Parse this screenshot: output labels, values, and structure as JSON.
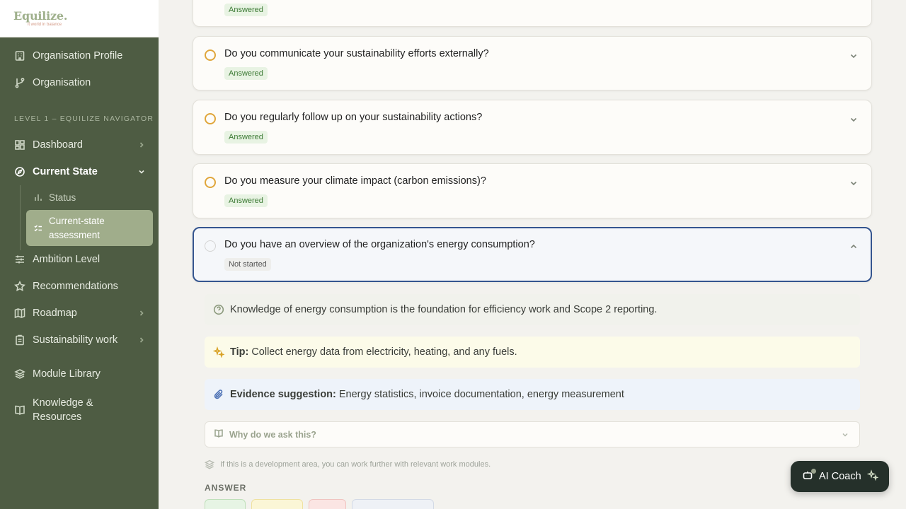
{
  "brand": {
    "name": "Equilize.",
    "tagline": "it world in balance"
  },
  "sidebar": {
    "top_items": [
      {
        "label": "Organisation Profile",
        "icon": "building-icon"
      },
      {
        "label": "Organisation",
        "icon": "git-branch-icon"
      }
    ],
    "section_label": "LEVEL 1 – EQUILIZE NAVIGATOR",
    "items": [
      {
        "label": "Dashboard",
        "icon": "dashboard-icon",
        "expandable": true
      },
      {
        "label": "Current State",
        "icon": "compass-icon",
        "expanded": true
      },
      {
        "label": "Ambition Level",
        "icon": "sliders-icon"
      },
      {
        "label": "Recommendations",
        "icon": "star-icon"
      },
      {
        "label": "Roadmap",
        "icon": "map-icon",
        "expandable": true
      },
      {
        "label": "Sustainability work",
        "icon": "clipboard-icon",
        "expandable": true
      },
      {
        "label": "Module Library",
        "icon": "layers-icon"
      },
      {
        "label": "Knowledge & Resources",
        "icon": "book-icon"
      }
    ],
    "sub_items": [
      {
        "label": "Status",
        "icon": "bar-chart-icon"
      },
      {
        "label": "Current-state assessment",
        "icon": "list-check-icon",
        "active": true
      }
    ]
  },
  "questions": [
    {
      "text": "",
      "status": "Answered"
    },
    {
      "text": "Do you communicate your sustainability efforts externally?",
      "status": "Answered"
    },
    {
      "text": "Do you regularly follow up on your sustainability actions?",
      "status": "Answered"
    },
    {
      "text": "Do you measure your climate impact (carbon emissions)?",
      "status": "Answered"
    },
    {
      "text": "Do you have an overview of the organization's energy consumption?",
      "status": "Not started"
    }
  ],
  "detail": {
    "description": "Knowledge of energy consumption is the foundation for efficiency work and Scope 2 reporting.",
    "tip_label": "Tip:",
    "tip_text": "Collect energy data from electricity, heating, and any fuels.",
    "evidence_label": "Evidence suggestion:",
    "evidence_text": "Energy statistics, invoice documentation, energy measurement",
    "why_label": "Why do we ask this?",
    "dev_hint": "If this is a development area, you can work further with relevant work modules.",
    "answer_label": "ANSWER"
  },
  "ai_coach": {
    "label": "AI Coach"
  },
  "colors": {
    "sidebar_bg": "#4e5c43",
    "active_bg": "#a0ad8b",
    "answered_badge": "#3c7a34",
    "focus_border": "#34558f",
    "pending_ring": "#e0a63b"
  }
}
